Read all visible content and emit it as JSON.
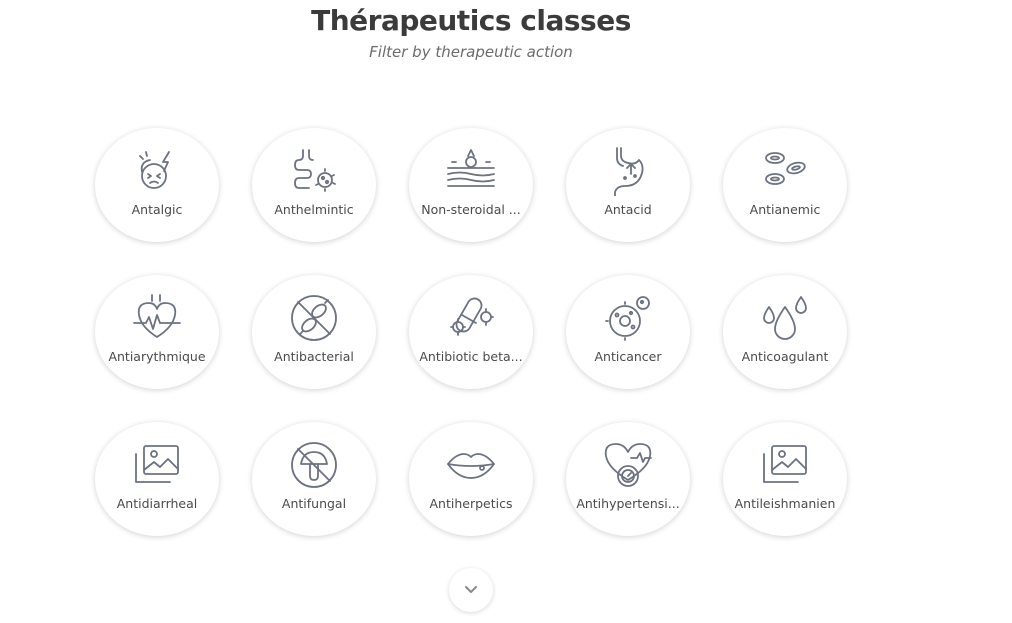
{
  "header": {
    "title": "Thérapeutics classes",
    "subtitle": "Filter by therapeutic action"
  },
  "classes": [
    {
      "label": "Antalgic",
      "icon": "headache-icon"
    },
    {
      "label": "Anthelmintic",
      "icon": "intestine-parasite-icon"
    },
    {
      "label": "Non-steroidal ...",
      "icon": "skin-inflammation-icon"
    },
    {
      "label": "Antacid",
      "icon": "stomach-icon"
    },
    {
      "label": "Antianemic",
      "icon": "red-blood-cells-icon"
    },
    {
      "label": "Antiarythmique",
      "icon": "heart-rhythm-icon"
    },
    {
      "label": "Antibacterial",
      "icon": "no-bacteria-icon"
    },
    {
      "label": "Antibiotic beta...",
      "icon": "capsule-bacteria-icon"
    },
    {
      "label": "Anticancer",
      "icon": "cancer-cell-icon"
    },
    {
      "label": "Anticoagulant",
      "icon": "blood-drops-icon"
    },
    {
      "label": "Antidiarrheal",
      "icon": "image-placeholder-icon"
    },
    {
      "label": "Antifungal",
      "icon": "no-mushroom-icon"
    },
    {
      "label": "Antiherpetics",
      "icon": "lips-icon"
    },
    {
      "label": "Antihypertensi...",
      "icon": "heart-pressure-gauge-icon"
    },
    {
      "label": "Antileishmanien",
      "icon": "image-placeholder-icon"
    }
  ],
  "scroll": {
    "icon": "chevron-down-icon"
  },
  "colors": {
    "icon_stroke": "#6b7280",
    "title": "#3b3b3b",
    "subtitle": "#6b6b6b"
  }
}
